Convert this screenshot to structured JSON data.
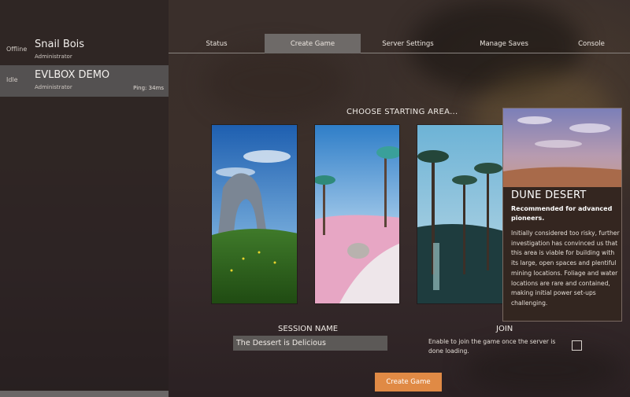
{
  "sidebar": {
    "servers": [
      {
        "state": "Offline",
        "name": "Snail Bois",
        "role": "Administrator",
        "ping": ""
      },
      {
        "state": "Idle",
        "name": "EVLBOX DEMO",
        "role": "Administrator",
        "ping": "Ping: 34ms"
      }
    ]
  },
  "tabs": [
    {
      "label": "Status",
      "active": false
    },
    {
      "label": "Create Game",
      "active": true
    },
    {
      "label": "Server Settings",
      "active": false
    },
    {
      "label": "Manage Saves",
      "active": false
    },
    {
      "label": "Console",
      "active": false
    }
  ],
  "main": {
    "heading": "CHOOSE STARTING AREA...",
    "areas": [
      {
        "id": "grass-fields"
      },
      {
        "id": "rocky-desert"
      },
      {
        "id": "northern-forest"
      },
      {
        "id": "dune-desert"
      }
    ],
    "detail": {
      "title": "DUNE DESERT",
      "subtitle": "Recommended for advanced pioneers.",
      "body": "Initially considered too risky, further investigation has convinced us that this area is viable for building with its large, open spaces and plentiful mining locations. Foliage and water locations are rare and contained, making initial power set-ups challenging."
    },
    "session": {
      "label": "SESSION NAME",
      "value": "The Dessert is Delicious"
    },
    "join": {
      "label": "JOIN",
      "description": "Enable to join the game once the server is done loading.",
      "checked": false
    },
    "create_button": "Create Game"
  },
  "colors": {
    "accent": "#e08a45",
    "active_tab": "#6e6a68",
    "selected_server": "#545151"
  }
}
